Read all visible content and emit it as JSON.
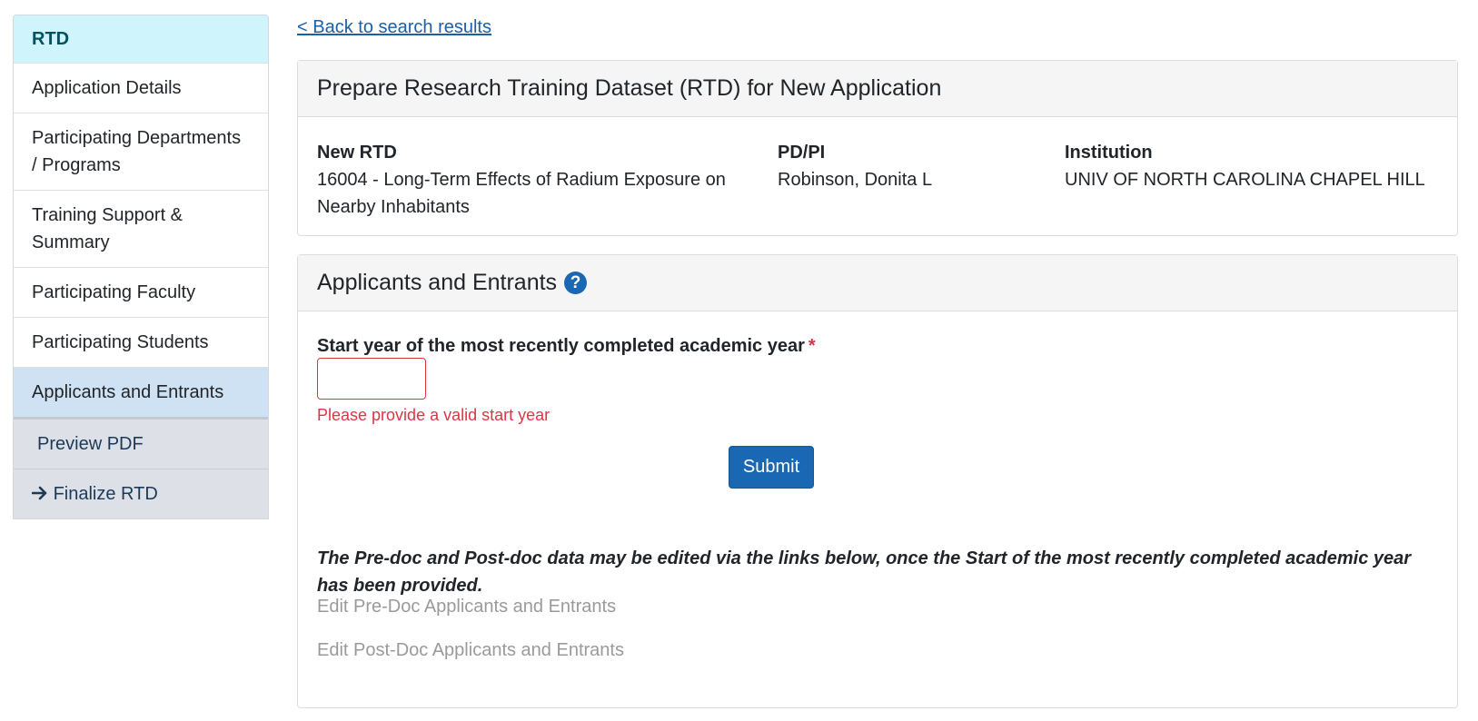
{
  "sidebar": {
    "header": "RTD",
    "items": [
      {
        "label": "Application Details"
      },
      {
        "label": "Participating Departments / Programs"
      },
      {
        "label": "Training Support & Summary"
      },
      {
        "label": "Participating Faculty"
      },
      {
        "label": "Participating Students"
      },
      {
        "label": "Applicants and Entrants"
      }
    ],
    "actions": [
      {
        "label": "Preview PDF"
      },
      {
        "label": "Finalize RTD",
        "icon": "arrow-right-icon"
      }
    ]
  },
  "back_link": "< Back to search results",
  "summary": {
    "title": "Prepare Research Training Dataset (RTD) for New Application",
    "rtd_label": "New RTD",
    "rtd_value": "16004 - Long-Term Effects of Radium Exposure on Nearby Inhabitants",
    "pi_label": "PD/PI",
    "pi_value": "Robinson, Donita L",
    "inst_label": "Institution",
    "inst_value": "UNIV OF NORTH CAROLINA CHAPEL HILL"
  },
  "section": {
    "title": "Applicants and Entrants",
    "help_icon": "question-circle-icon",
    "field_label": "Start year of the most recently completed academic year",
    "required_mark": "*",
    "input_value": "",
    "error": "Please provide a valid start year",
    "submit": "Submit",
    "note": "The Pre-doc and Post-doc data may be edited via the links below, once the Start of the most recently completed academic year has been provided.",
    "link_predoc": "Edit Pre-Doc Applicants and Entrants",
    "link_postdoc": "Edit Post-Doc Applicants and Entrants"
  },
  "colors": {
    "accent": "#1a67b3",
    "error": "#dc3545",
    "sidebar_header_bg": "#cff4fc",
    "sidebar_active_bg": "#cfe2f3"
  }
}
